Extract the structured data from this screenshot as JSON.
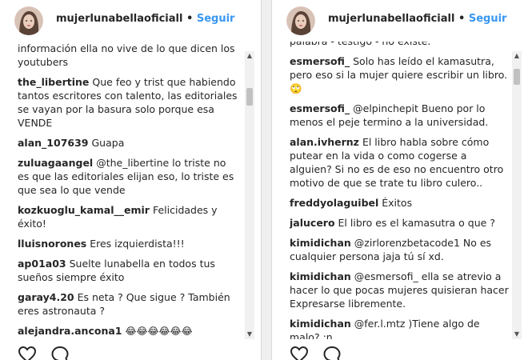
{
  "left": {
    "username": "mujerlunabellaoficiall",
    "separator": "•",
    "follow_label": "Seguir",
    "partial_top": "información ella no vive de lo que dicen los youtubers",
    "comments": [
      {
        "user": "the_libertine",
        "text": "Que feo y trist que habiendo tantos escritores con talento, las editoriales se vayan por la basura solo porque esa VENDE"
      },
      {
        "user": "alan_107639",
        "text": "Guapa"
      },
      {
        "user": "zuluagaangel",
        "text": "@the_libertine lo triste no es que las editoriales elijan eso, lo triste es que sea lo que vende"
      },
      {
        "user": "kozkuoglu_kamal__emir",
        "text": "Felicidades y éxito!"
      },
      {
        "user": "lluisnorones",
        "text": "Eres izquierdista!!!"
      },
      {
        "user": "ap01a03",
        "text": "Suelte lunabella en todos tus sueños siempre éxito"
      },
      {
        "user": "garay4.20",
        "text": "Es neta ? Que sigue ? También eres astronauta ?"
      },
      {
        "user": "alejandra.ancona1",
        "text": "😂😂😂😂😂😂"
      }
    ]
  },
  "right": {
    "username": "mujerlunabellaoficiall",
    "separator": "•",
    "follow_label": "Seguir",
    "partial_top": "palabra - testigo - no existe.",
    "comments": [
      {
        "user": "esmersofi_",
        "text": "Solo has leído el kamasutra, pero eso si la mujer quiere escribir un libro. 🙄"
      },
      {
        "user": "esmersofi_",
        "text": "@elpinchepit Bueno por lo menos el peje termino a la universidad."
      },
      {
        "user": "alan.ivhernz",
        "text": "El libro habla sobre cómo putear en la vida o como cogerse a alguien? Si no es de eso no encuentro otro motivo de que se trate tu libro culero.."
      },
      {
        "user": "freddyolaguibel",
        "text": "Éxitos"
      },
      {
        "user": "jalucero",
        "text": "El libro es el kamasutra o que ?"
      },
      {
        "user": "kimidichan",
        "text": "@zirlorenzbetacode1 No es cualquier persona jaja tú sí xd."
      },
      {
        "user": "kimidichan",
        "text": "@esmersofi_ ella se atrevio a hacer lo que pocas mujeres quisieran hacer Expresarse libremente."
      },
      {
        "user": "kimidichan",
        "text": "@fer.l.mtz )Tiene algo de malo? :n"
      }
    ]
  },
  "icons": {
    "like": "heart-icon",
    "comment": "comment-icon",
    "scroll_up": "▲",
    "scroll_down": "▼"
  }
}
